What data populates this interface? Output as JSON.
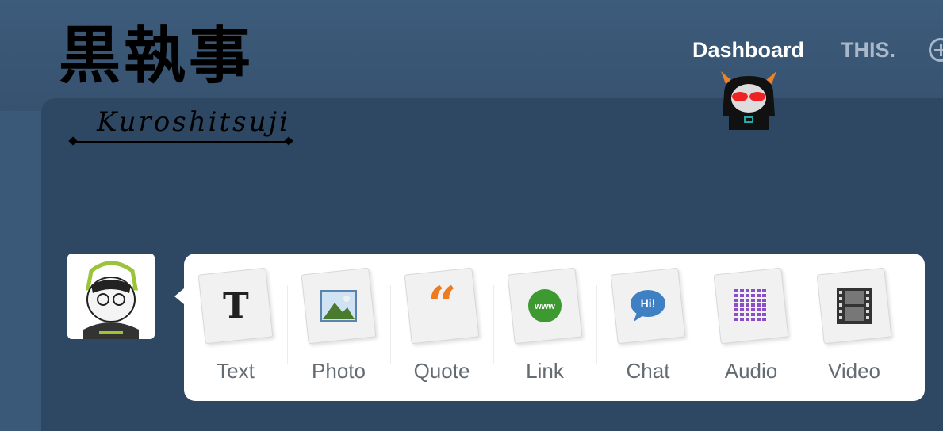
{
  "logo": {
    "kanji": "黒執事",
    "roman": "Kuroshitsuji"
  },
  "nav": {
    "dashboard": "Dashboard",
    "this": "THIS."
  },
  "post_types": [
    {
      "label": "Text",
      "icon": "text-icon",
      "glyph": "T",
      "color": "#222222"
    },
    {
      "label": "Photo",
      "icon": "photo-icon",
      "color": "#2f6fa8"
    },
    {
      "label": "Quote",
      "icon": "quote-icon",
      "glyph": "“",
      "color": "#ee7b1d"
    },
    {
      "label": "Link",
      "icon": "link-icon",
      "glyph": "www",
      "color": "#3c9a31"
    },
    {
      "label": "Chat",
      "icon": "chat-icon",
      "glyph": "Hi!",
      "color": "#3f7fc4"
    },
    {
      "label": "Audio",
      "icon": "audio-icon",
      "color": "#8a4fc6"
    },
    {
      "label": "Video",
      "icon": "video-icon",
      "color": "#333333"
    }
  ]
}
